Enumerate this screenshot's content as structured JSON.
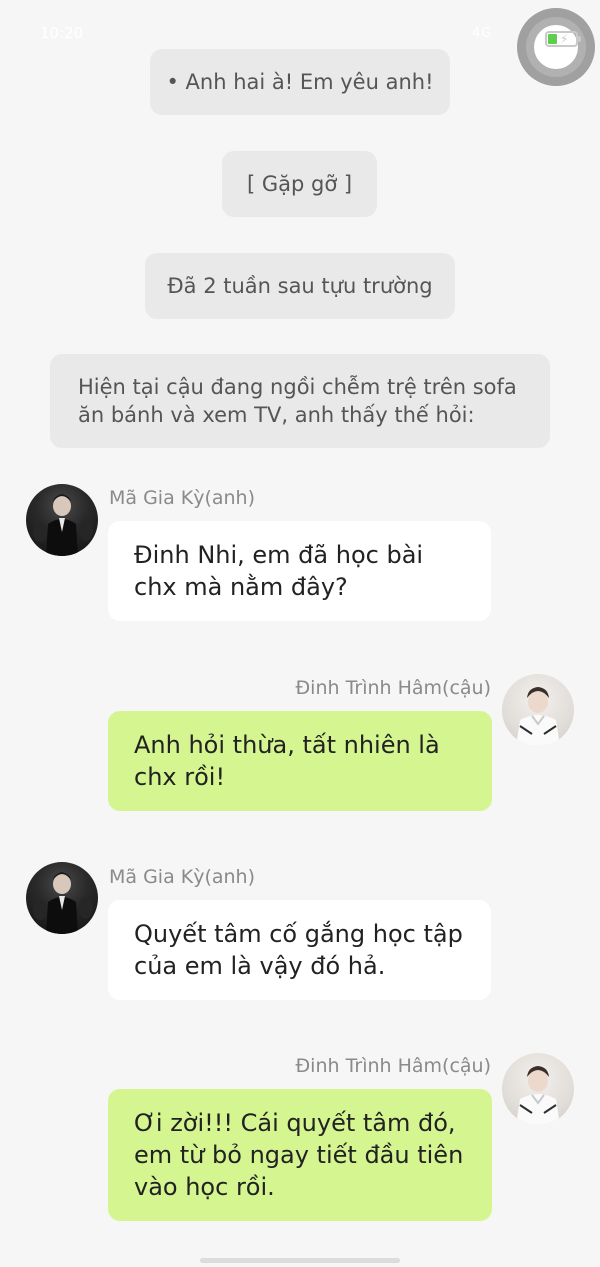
{
  "status_bar": {
    "time": "10:20",
    "signal": "4G",
    "battery_color": "#5fce4d"
  },
  "narrations": [
    "• Anh hai à! Em yêu anh!",
    "[ Gặp gỡ ]",
    "Đã 2 tuần sau tựu trường",
    "Hiện tại cậu đang ngồi chễm trệ trên sofa ăn bánh và xem TV, anh thấy thế hỏi:"
  ],
  "messages": [
    {
      "sender": "Mã Gia Kỳ(anh)",
      "side": "left",
      "avatar": "avatar-dark-suit",
      "text": "Đinh Nhi, em đã học bài chx mà nằm đây?"
    },
    {
      "sender": "Đinh Trình Hâm(cậu)",
      "side": "right",
      "avatar": "avatar-white-sweater",
      "text": "Anh hỏi thừa, tất nhiên là chx rồi!"
    },
    {
      "sender": "Mã Gia Kỳ(anh)",
      "side": "left",
      "avatar": "avatar-dark-suit",
      "text": "Quyết tâm cố gắng học tập của em là vậy đó hả."
    },
    {
      "sender": "Đinh Trình Hâm(cậu)",
      "side": "right",
      "avatar": "avatar-white-sweater",
      "text": "Ơi zời!!! Cái quyết tâm đó, em từ bỏ ngay tiết đầu tiên vào học rồi."
    }
  ],
  "colors": {
    "background": "#f6f6f6",
    "narration_bg": "#e9e9e9",
    "incoming_bubble": "#ffffff",
    "outgoing_bubble": "#d5f590",
    "name_text": "#8a8a8a"
  }
}
